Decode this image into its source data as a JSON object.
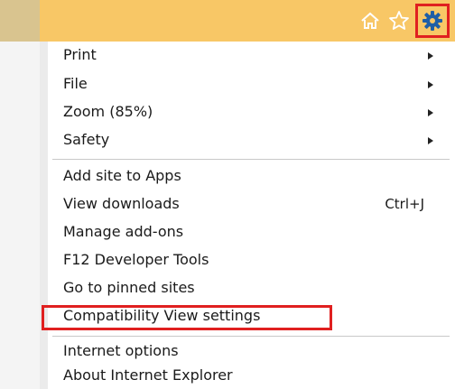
{
  "toolbar": {
    "icons": [
      "home-icon",
      "star-icon",
      "gear-icon"
    ],
    "highlight_color": "#e02020",
    "background": "#f8c766"
  },
  "menu": {
    "group1": [
      {
        "label": "Print",
        "submenu": true
      },
      {
        "label": "File",
        "submenu": true
      },
      {
        "label": "Zoom (85%)",
        "submenu": true
      },
      {
        "label": "Safety",
        "submenu": true
      }
    ],
    "group2": [
      {
        "label": "Add site to Apps"
      },
      {
        "label": "View downloads",
        "shortcut": "Ctrl+J"
      },
      {
        "label": "Manage add-ons"
      },
      {
        "label": "F12 Developer Tools"
      },
      {
        "label": "Go to pinned sites"
      },
      {
        "label": "Compatibility View settings",
        "highlighted": true
      }
    ],
    "group3": [
      {
        "label": "Internet options"
      },
      {
        "label": "About Internet Explorer"
      }
    ]
  }
}
